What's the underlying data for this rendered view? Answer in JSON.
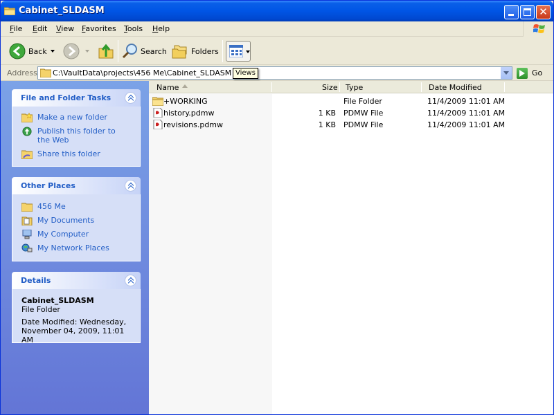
{
  "window": {
    "title": "Cabinet_SLDASM"
  },
  "menu": {
    "items": [
      "File",
      "Edit",
      "View",
      "Favorites",
      "Tools",
      "Help"
    ]
  },
  "toolbar": {
    "back_label": "Back",
    "search_label": "Search",
    "folders_label": "Folders"
  },
  "address": {
    "label": "Address",
    "value": "C:\\VaultData\\projects\\456 Me\\Cabinet_SLDASM",
    "go_label": "Go",
    "tooltip": "Views"
  },
  "tasks_panel": {
    "title": "File and Folder Tasks",
    "items": [
      {
        "label": "Make a new folder",
        "icon": "new-folder-icon"
      },
      {
        "label": "Publish this folder to the Web",
        "icon": "publish-web-icon"
      },
      {
        "label": "Share this folder",
        "icon": "share-folder-icon"
      }
    ]
  },
  "places_panel": {
    "title": "Other Places",
    "items": [
      {
        "label": "456 Me",
        "icon": "folder-icon"
      },
      {
        "label": "My Documents",
        "icon": "my-documents-icon"
      },
      {
        "label": "My Computer",
        "icon": "my-computer-icon"
      },
      {
        "label": "My Network Places",
        "icon": "network-places-icon"
      }
    ]
  },
  "details_panel": {
    "title": "Details",
    "name": "Cabinet_SLDASM",
    "type": "File Folder",
    "modified": "Date Modified: Wednesday, November 04, 2009, 11:01 AM"
  },
  "file_list": {
    "columns": [
      "Name",
      "Size",
      "Type",
      "Date Modified"
    ],
    "rows": [
      {
        "name": "+WORKING",
        "size": "",
        "type": "File Folder",
        "modified": "11/4/2009 11:01 AM",
        "icon": "folder-icon"
      },
      {
        "name": "history.pdmw",
        "size": "1 KB",
        "type": "PDMW File",
        "modified": "11/4/2009 11:01 AM",
        "icon": "pdmw-file-icon"
      },
      {
        "name": "revisions.pdmw",
        "size": "1 KB",
        "type": "PDMW File",
        "modified": "11/4/2009 11:01 AM",
        "icon": "pdmw-file-icon"
      }
    ]
  },
  "colors": {
    "title_bar": "#0055e5",
    "link_blue": "#215dc6",
    "task_pane": "#6f8ee0"
  }
}
